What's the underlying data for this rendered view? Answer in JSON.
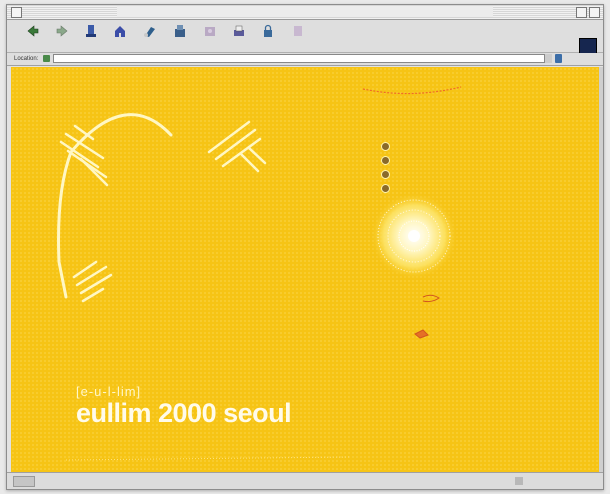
{
  "window": {
    "title": ""
  },
  "toolbar": {
    "buttons": [
      {
        "label": "",
        "icon": "back-icon",
        "color": "#3a7a3a"
      },
      {
        "label": "",
        "icon": "forward-icon",
        "color": "#8aa88a"
      },
      {
        "label": "",
        "icon": "reload-icon",
        "color": "#3b5aa8"
      },
      {
        "label": "",
        "icon": "home-icon",
        "color": "#3b4da8"
      },
      {
        "label": "",
        "icon": "search-icon",
        "color": "#2f5f8c"
      },
      {
        "label": "",
        "icon": "netscape-icon",
        "color": "#3a5f8a"
      },
      {
        "label": "",
        "icon": "images-icon",
        "color": "#b9a9c4"
      },
      {
        "label": "",
        "icon": "print-icon",
        "color": "#5a5a9a"
      },
      {
        "label": "",
        "icon": "security-icon",
        "color": "#3a6a9a"
      },
      {
        "label": "",
        "icon": "stop-icon",
        "color": "#c8b8d0"
      }
    ],
    "logo": ""
  },
  "location": {
    "label": "Location:",
    "url": "",
    "extra": [
      "",
      ""
    ]
  },
  "page": {
    "menu": [
      "",
      "",
      "",
      ""
    ],
    "left_caption": [
      "",
      ""
    ],
    "right_caption": [
      "",
      ""
    ],
    "mid_label": "",
    "brand_tag": "[e-u-l-lim]",
    "brand_title": "eullim 2000 seoul",
    "brand_sub": ""
  },
  "status": {
    "text": ""
  },
  "colors": {
    "page_background": "#f6c415",
    "text_light": "#fff8d0",
    "accent_orange": "#e7502a"
  }
}
